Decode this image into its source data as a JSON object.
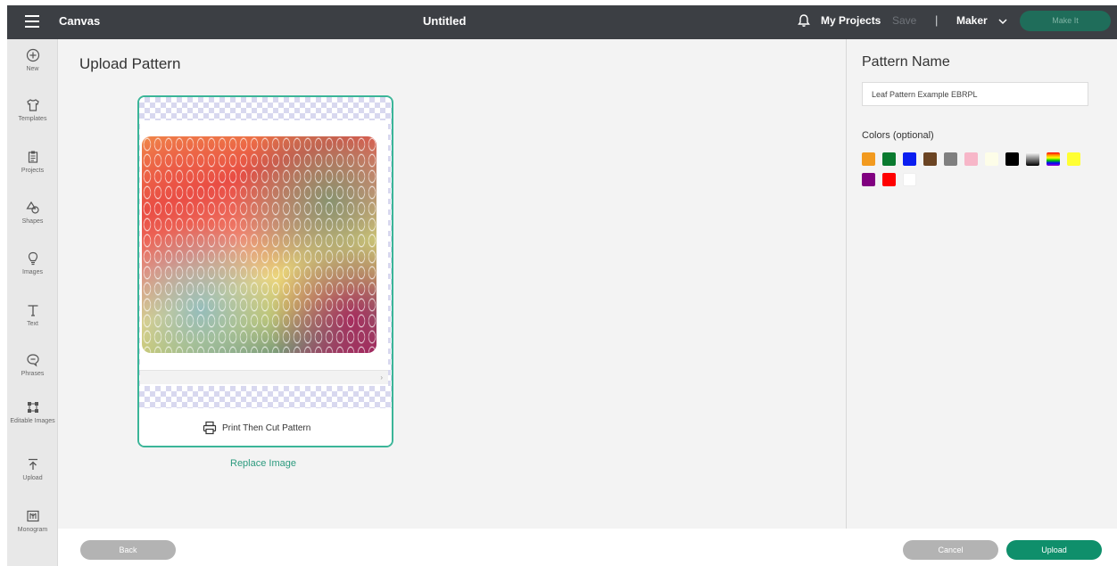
{
  "topbar": {
    "app_name": "Canvas",
    "doc_title": "Untitled",
    "my_projects": "My Projects",
    "save": "Save",
    "separator": "|",
    "machine": "Maker",
    "make_it": "Make It"
  },
  "leftnav": {
    "items": [
      {
        "label": "New",
        "icon": "plus-circle-icon"
      },
      {
        "label": "Templates",
        "icon": "shirt-icon"
      },
      {
        "label": "Projects",
        "icon": "clipboard-icon"
      },
      {
        "label": "Shapes",
        "icon": "shapes-icon"
      },
      {
        "label": "Images",
        "icon": "lightbulb-icon"
      },
      {
        "label": "Text",
        "icon": "text-icon"
      },
      {
        "label": "Phrases",
        "icon": "speech-bubble-icon"
      },
      {
        "label": "Editable Images",
        "icon": "editable-images-icon"
      },
      {
        "label": "Upload",
        "icon": "upload-icon"
      },
      {
        "label": "Monogram",
        "icon": "monogram-icon"
      }
    ]
  },
  "main": {
    "title": "Upload Pattern",
    "card_footer_label": "Print Then Cut Pattern",
    "replace_link": "Replace Image"
  },
  "panel": {
    "pattern_name_title": "Pattern Name",
    "pattern_name_value": "Leaf Pattern Example EBRPL",
    "colors_label": "Colors (optional)",
    "swatches": [
      {
        "name": "orange",
        "color": "#f29a1f"
      },
      {
        "name": "green",
        "color": "#0a7a2f"
      },
      {
        "name": "blue",
        "color": "#0a1ef0"
      },
      {
        "name": "brown",
        "color": "#6b4423"
      },
      {
        "name": "gray",
        "color": "#7f7f7f"
      },
      {
        "name": "pink",
        "color": "#f7b6c8"
      },
      {
        "name": "cream",
        "color": "#fdfde8"
      },
      {
        "name": "black",
        "color": "#000000"
      },
      {
        "name": "black-gradient",
        "color": "#333333"
      },
      {
        "name": "rainbow",
        "color": "#ff0000"
      },
      {
        "name": "yellow",
        "color": "#ffff33"
      },
      {
        "name": "purple",
        "color": "#800080"
      },
      {
        "name": "red",
        "color": "#ff0000"
      },
      {
        "name": "white",
        "color": "#ffffff"
      }
    ]
  },
  "bottombar": {
    "back": "Back",
    "cancel": "Cancel",
    "upload": "Upload"
  }
}
